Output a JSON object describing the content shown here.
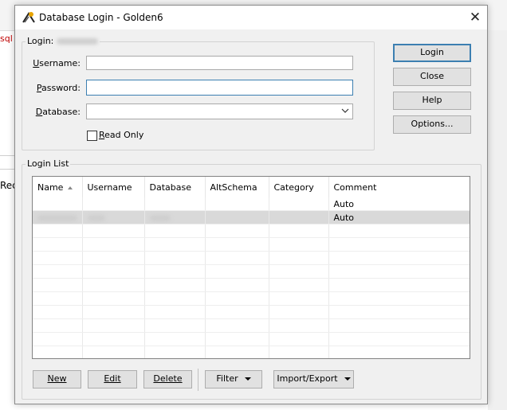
{
  "window": {
    "title": "Database Login - Golden6",
    "close_symbol": "✕"
  },
  "background": {
    "sql_text": "sql",
    "rec_text": "Rec"
  },
  "login_group": {
    "legend": "Login:",
    "username_label": "Username:",
    "password_label": "Password:",
    "database_label": "Database:",
    "username_value": "",
    "password_value": "",
    "database_value": "",
    "read_only_label": "Read Only",
    "read_only_checked": false
  },
  "buttons": {
    "login": "Login",
    "close": "Close",
    "help": "Help",
    "options": "Options..."
  },
  "login_list": {
    "legend": "Login List",
    "columns": [
      "Name",
      "Username",
      "Database",
      "AltSchema",
      "Category",
      "Comment"
    ],
    "sort_column": "Name",
    "rows": [
      {
        "name": "",
        "username": "",
        "database": "",
        "altschema": "",
        "category": "",
        "comment": "Auto"
      },
      {
        "name": "",
        "username": "",
        "database": "",
        "altschema": "",
        "category": "",
        "comment": "Auto"
      }
    ]
  },
  "bottom_buttons": {
    "new": "New",
    "edit": "Edit",
    "delete": "Delete",
    "filter": "Filter",
    "import_export": "Import/Export"
  },
  "colors": {
    "focus_border": "#3c7fb1",
    "selected_row": "#d9d9d9",
    "dialog_bg": "#f0f0f0"
  }
}
